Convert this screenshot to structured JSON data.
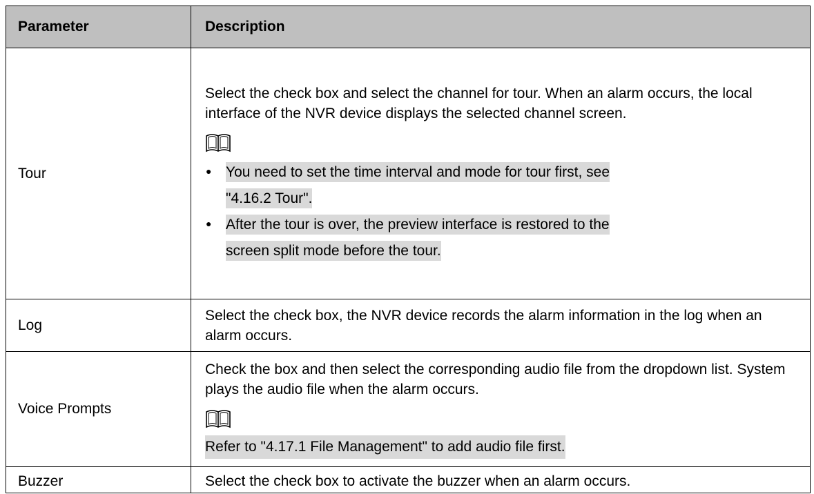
{
  "table": {
    "headers": {
      "parameter": "Parameter",
      "description": "Description"
    },
    "rows": [
      {
        "parameter": "Tour",
        "description": "Select the check box and select the channel for tour. When an alarm occurs, the local interface of the NVR device displays the selected channel screen.",
        "note_icon": "book-note-icon",
        "notes": [
          {
            "line1": "You need to set the time interval and mode for tour first, see",
            "line2": "\"4.16.2 Tour\"."
          },
          {
            "line1": "After the tour is over, the preview interface is restored to the",
            "line2": "screen split mode before the tour."
          }
        ]
      },
      {
        "parameter": "Log",
        "description": "Select the check box, the NVR device records the alarm information in the log when an alarm occurs."
      },
      {
        "parameter": "Voice Prompts",
        "description": "Check the box and then select the corresponding audio file from the dropdown list. System plays the audio file when the alarm occurs.",
        "note_icon": "book-note-icon",
        "note": "Refer to \"4.17.1 File Management\" to add audio file first."
      },
      {
        "parameter": "Buzzer",
        "description": "Select the check box to activate the buzzer when an alarm occurs."
      }
    ]
  },
  "colors": {
    "header_bg": "#bfbfbf",
    "note_highlight": "#d9d9d9",
    "border": "#000000"
  }
}
